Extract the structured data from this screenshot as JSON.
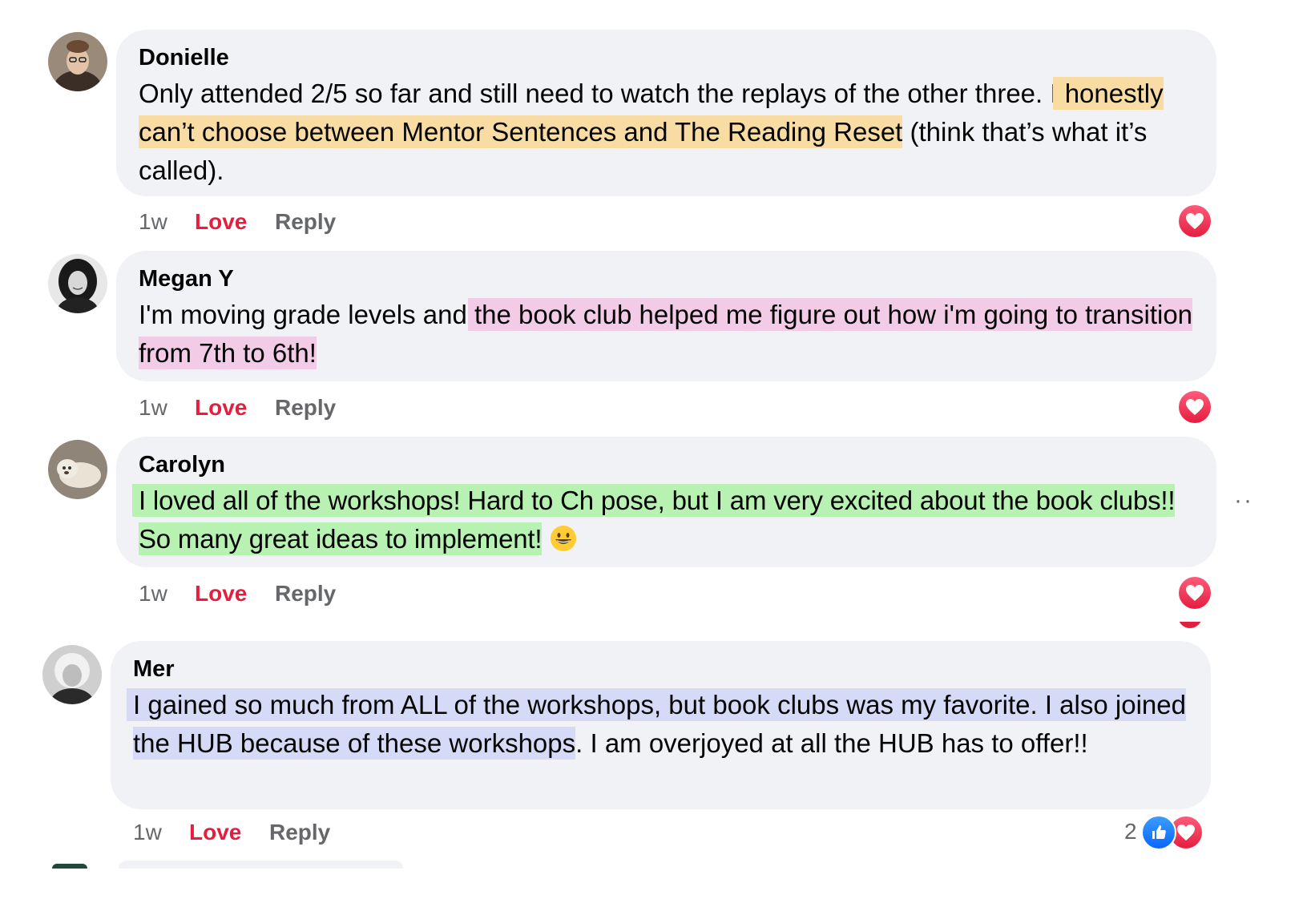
{
  "comments": [
    {
      "author": "Donielle",
      "text_plain_1": "Only attended 2/5 so far and still need to watch the replays of the other three. I ",
      "text_highlight_1": "honestly can’t choose between Mentor Sentences and The Reading Reset",
      "text_plain_2": " (think that’s what it’s called).",
      "time": "1w",
      "love_label": "Love",
      "reply_label": "Reply",
      "reaction_icon": "heart-icon",
      "highlight_color": "#f9dca3"
    },
    {
      "author": "Megan Y",
      "text_plain_1": "I'm moving grade levels and ",
      "text_highlight_1": "the book club helped me figure out how i'm going to transition from 7th to 6th!",
      "time": "1w",
      "love_label": "Love",
      "reply_label": "Reply",
      "reaction_icon": "heart-icon",
      "highlight_color": "#f2cce6"
    },
    {
      "author": "Carolyn",
      "text_highlight_1": "I loved all of the workshops! Hard to Ch pose, but I am very excited about the book clubs!! So many great ideas to implement!",
      "emoji": "grinning-face-emoji",
      "time": "1w",
      "love_label": "Love",
      "reply_label": "Reply",
      "reaction_icon": "heart-icon",
      "more_label": "··",
      "highlight_color": "#b8f2b2"
    },
    {
      "author": "Mer",
      "text_highlight_1": "I gained so much from ALL of the workshops, but book clubs was my favorite. I also joined the HUB because of these workshops",
      "text_plain_2": ". I am overjoyed at all the HUB has to offer!!",
      "time": "1w",
      "love_label": "Love",
      "reply_label": "Reply",
      "reaction_count": "2",
      "reaction_icons": [
        "like-icon",
        "heart-icon"
      ],
      "highlight_color": "#d5daf7"
    }
  ]
}
